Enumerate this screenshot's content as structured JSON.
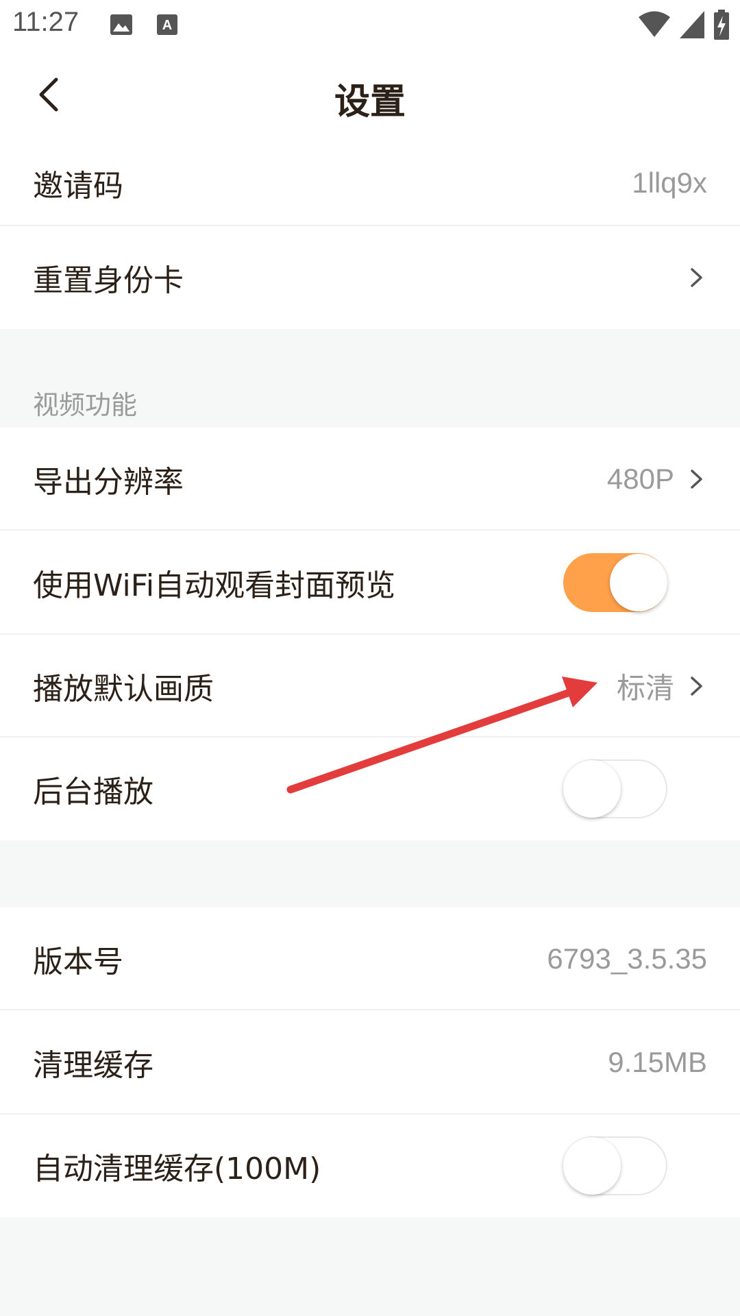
{
  "status_bar": {
    "time": "11:27",
    "icons": [
      "image-icon",
      "keyboard-a-icon",
      "wifi-icon",
      "cell-signal-icon",
      "battery-charging-icon"
    ]
  },
  "header": {
    "title": "设置",
    "back_icon": "chevron-left-icon"
  },
  "rows": {
    "invite_code": {
      "label": "邀请码",
      "value": "1llq9x"
    },
    "reset_id_card": {
      "label": "重置身份卡"
    },
    "video_section": {
      "title": "视频功能"
    },
    "export_resolution": {
      "label": "导出分辨率",
      "value": "480P"
    },
    "wifi_autoplay_cover": {
      "label": "使用WiFi自动观看封面预览",
      "toggle": true
    },
    "default_quality": {
      "label": "播放默认画质",
      "value": "标清"
    },
    "background_play": {
      "label": "后台播放",
      "toggle": false
    },
    "version": {
      "label": "版本号",
      "value": "6793_3.5.35"
    },
    "clear_cache": {
      "label": "清理缓存",
      "value": "9.15MB"
    },
    "auto_clear_cache": {
      "label": "自动清理缓存(100M)",
      "toggle": false
    }
  },
  "colors": {
    "accent": "#ffa04a",
    "annotation_arrow": "#e23c3c",
    "background": "#f6f7f7",
    "text_primary": "#2b2118",
    "text_secondary": "#9a9a9a"
  }
}
